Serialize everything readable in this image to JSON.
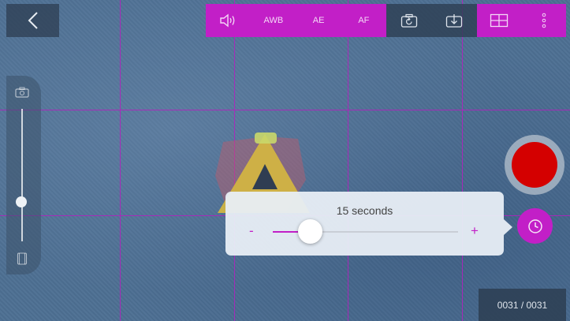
{
  "toolbar": {
    "sound_icon": "speaker-icon",
    "awb_label": "AWB",
    "ae_label": "AE",
    "af_label": "AF",
    "switch_camera_icon": "camera-switch-icon",
    "import_icon": "download-icon",
    "grid_icon": "grid-icon",
    "more_icon": "more-vertical-icon"
  },
  "zoom": {
    "top_icon": "camera-icon",
    "bottom_icon": "film-icon",
    "level": 0.3
  },
  "timer": {
    "value_label": "15 seconds",
    "minus_label": "-",
    "plus_label": "+",
    "slider_fraction": 0.2
  },
  "frame_counter": "0031 / 0031",
  "colors": {
    "accent": "#c21fc7",
    "record": "#d40000",
    "panel": "#2d3e52"
  }
}
